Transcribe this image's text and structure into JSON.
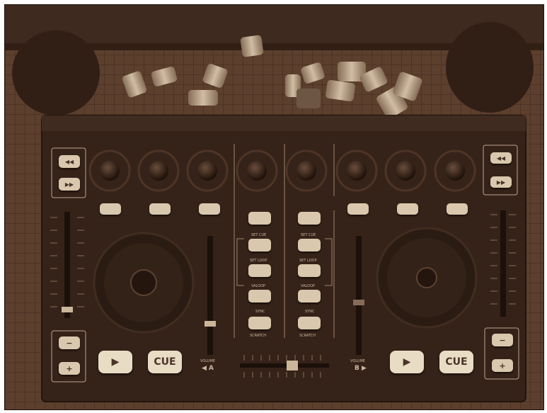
{
  "controller": {
    "left_deck": {
      "volume_label": "VOLUME",
      "deck_letter": "◀ A",
      "play_glyph": "▶",
      "cue_label": "CUE",
      "minus_glyph": "−",
      "plus_glyph": "+",
      "rew_glyph": "◀◀",
      "ffw_glyph": "▶▶"
    },
    "right_deck": {
      "volume_label": "VOLUME",
      "deck_letter": "B ▶",
      "play_glyph": "▶",
      "cue_label": "CUE",
      "minus_glyph": "−",
      "plus_glyph": "+",
      "rew_glyph": "◀◀",
      "ffw_glyph": "▶▶"
    },
    "center_left_labels": [
      "",
      "SET CUE",
      "SET LOOP",
      "VALOOP",
      "SYNC",
      "SCRATCH"
    ],
    "center_right_labels": [
      "",
      "SET CUE",
      "SET LOOP",
      "VALOOP",
      "SYNC",
      "SCRATCH"
    ]
  },
  "colors": {
    "tint": "#4a3328",
    "panel": "#2e201a",
    "button": "#e8dcc4"
  }
}
